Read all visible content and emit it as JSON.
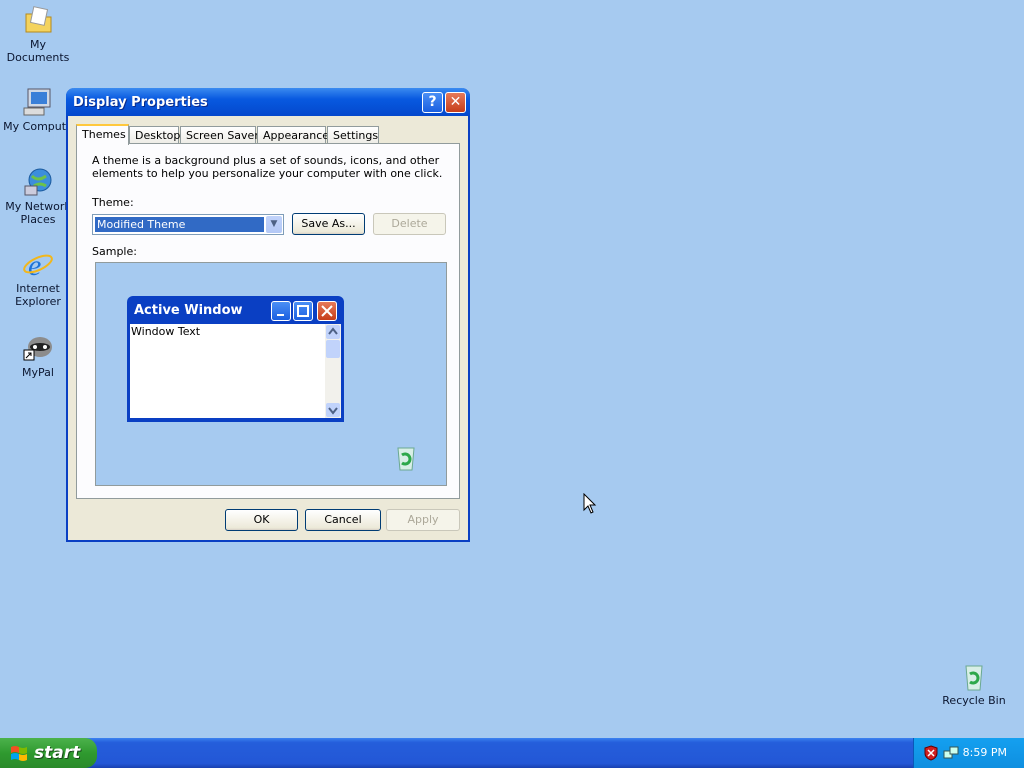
{
  "desktop": {
    "icons": [
      {
        "label": "My Documents"
      },
      {
        "label": "My Compute"
      },
      {
        "label": "My Network Places"
      },
      {
        "label": "Internet Explorer"
      },
      {
        "label": "MyPal"
      },
      {
        "label": "Recycle Bin"
      }
    ]
  },
  "window": {
    "title": "Display Properties",
    "help_glyph": "?",
    "close_glyph": "✕",
    "tabs": [
      {
        "label": "Themes",
        "active": true
      },
      {
        "label": "Desktop"
      },
      {
        "label": "Screen Saver"
      },
      {
        "label": "Appearance"
      },
      {
        "label": "Settings"
      }
    ],
    "description": "A theme is a background plus a set of sounds, icons, and other elements to help you personalize your computer with one click.",
    "theme_label": "Theme:",
    "theme_value": "Modified Theme",
    "save_as_label": "Save As...",
    "delete_label": "Delete",
    "sample_label": "Sample:",
    "sample": {
      "window_title": "Active Window",
      "window_text": "Window Text"
    },
    "ok_label": "OK",
    "cancel_label": "Cancel",
    "apply_label": "Apply"
  },
  "taskbar": {
    "start_label": "start",
    "clock": "8:59 PM"
  }
}
